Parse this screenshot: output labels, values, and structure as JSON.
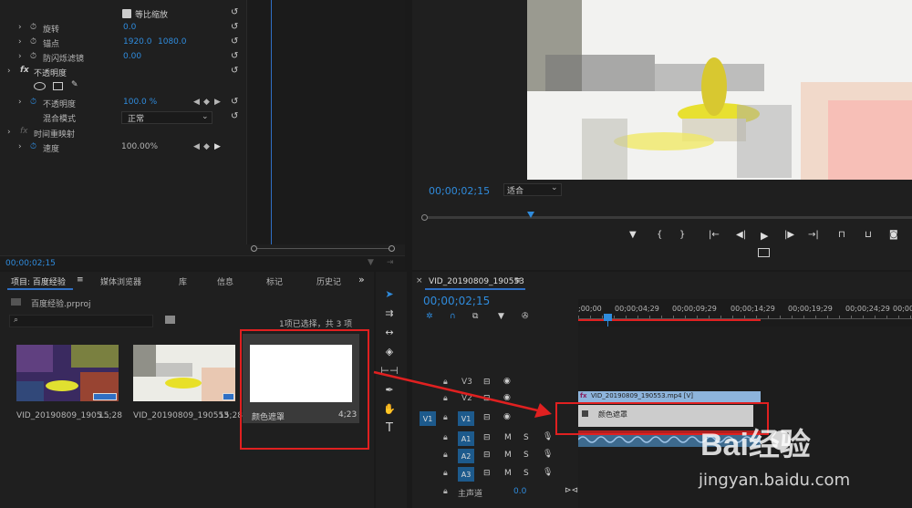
{
  "effects": {
    "uniform_scale": "等比缩放",
    "rotation": {
      "label": "旋转",
      "value": "0.0"
    },
    "anchor": {
      "label": "锚点",
      "x": "1920.0",
      "y": "1080.0"
    },
    "antiflicker": {
      "label": "防闪烁滤镜",
      "value": "0.00"
    },
    "opacity_header": "不透明度",
    "opacity": {
      "label": "不透明度",
      "value": "100.0 %"
    },
    "blend": {
      "label": "混合模式",
      "value": "正常"
    },
    "time_remap": "时间重映射",
    "speed": {
      "label": "速度",
      "value": "100.00%"
    },
    "timecode": "00;00;02;15",
    "fx": "fx"
  },
  "program": {
    "timecode": "00;00;02;15",
    "fit": "适合"
  },
  "project": {
    "tabs": [
      "项目: 百度经验",
      "媒体浏览器",
      "库",
      "信息",
      "标记",
      "历史记"
    ],
    "more": "»",
    "file": "百度经验.prproj",
    "selection": "1项已选择，共 3 项",
    "items": [
      {
        "name": "VID_20190809_1905...",
        "duration": "15;28"
      },
      {
        "name": "VID_20190809_190553",
        "duration": "15;28"
      },
      {
        "name": "颜色遮罩",
        "duration": "4;23"
      }
    ]
  },
  "timeline": {
    "tab": "VID_20190809_190553",
    "close": "×",
    "timecode": "00;00;02;15",
    "ruler": [
      ";00;00",
      "00;00;04;29",
      "00;00;09;29",
      "00;00;14;29",
      "00;00;19;29",
      "00;00;24;29",
      "00;00"
    ],
    "tracks": {
      "v3": "V3",
      "v2": "V2",
      "v1": "V1",
      "a1": "A1",
      "a2": "A2",
      "a3": "A3",
      "src_v1": "V1",
      "m": "M",
      "s": "S"
    },
    "master": {
      "label": "主声道",
      "value": "0.0"
    },
    "clip_video": "VID_20190809_190553.mp4 [V]",
    "clip_matte": "颜色遮罩"
  },
  "watermark": {
    "logo": "Bai经验",
    "url": "jingyan.baidu.com"
  }
}
